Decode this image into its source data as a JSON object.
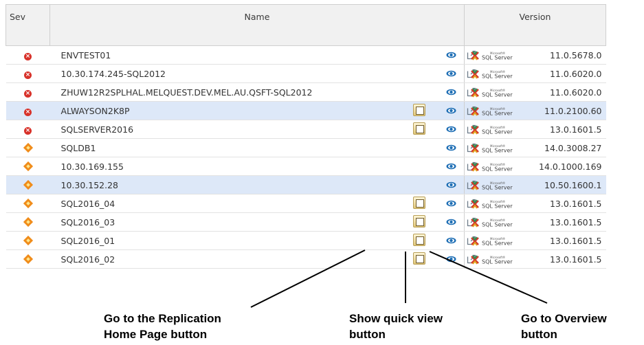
{
  "columns": {
    "sev": "Sev",
    "name": "Name",
    "version": "Version"
  },
  "rows": [
    {
      "severity": "critical",
      "name": "ENVTEST01",
      "replication": false,
      "version": "11.0.5678.0",
      "selected": false
    },
    {
      "severity": "critical",
      "name": "10.30.174.245-SQL2012",
      "replication": false,
      "version": "11.0.6020.0",
      "selected": false
    },
    {
      "severity": "critical",
      "name": "ZHUW12R2SPLHAL.MELQUEST.DEV.MEL.AU.QSFT-SQL2012",
      "replication": false,
      "version": "11.0.6020.0",
      "selected": false
    },
    {
      "severity": "critical",
      "name": "ALWAYSON2K8P",
      "replication": true,
      "version": "11.0.2100.60",
      "selected": true
    },
    {
      "severity": "critical",
      "name": "SQLSERVER2016",
      "replication": true,
      "version": "13.0.1601.5",
      "selected": false
    },
    {
      "severity": "warning",
      "name": "SQLDB1",
      "replication": false,
      "version": "14.0.3008.27",
      "selected": false
    },
    {
      "severity": "warning",
      "name": "10.30.169.155",
      "replication": false,
      "version": "14.0.1000.169",
      "selected": false
    },
    {
      "severity": "warning",
      "name": "10.30.152.28",
      "replication": false,
      "version": "10.50.1600.1",
      "selected": true
    },
    {
      "severity": "warning",
      "name": "SQL2016_04",
      "replication": true,
      "version": "13.0.1601.5",
      "selected": false
    },
    {
      "severity": "warning",
      "name": "SQL2016_03",
      "replication": true,
      "version": "13.0.1601.5",
      "selected": false
    },
    {
      "severity": "warning",
      "name": "SQL2016_01",
      "replication": true,
      "version": "13.0.1601.5",
      "selected": false
    },
    {
      "severity": "warning",
      "name": "SQL2016_02",
      "replication": true,
      "version": "13.0.1601.5",
      "selected": false
    }
  ],
  "logo": {
    "small": "Microsoft®",
    "big": "SQL Server"
  },
  "callouts": {
    "replication": [
      "Go to the Replication",
      "Home Page button"
    ],
    "quickview": [
      "Show quick view",
      "button"
    ],
    "overview": [
      "Go to Overview",
      "button"
    ]
  },
  "colors": {
    "critical": "#d8322a",
    "warning": "#f08c1a",
    "selected_row": "#dde8f8",
    "eye": "#1f6fb5"
  }
}
